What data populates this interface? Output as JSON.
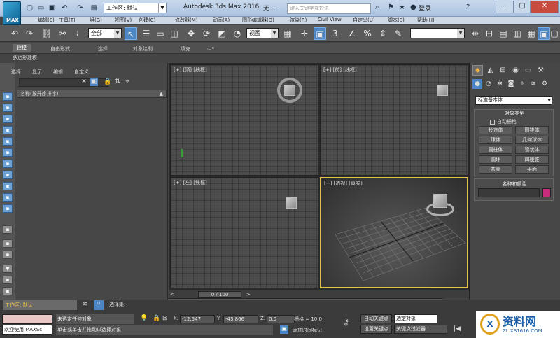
{
  "title": {
    "app": "Autodesk 3ds Max 2016",
    "doc": "无...",
    "workspace": "工作区: 默认",
    "search_placeholder": "键入关键字或短语",
    "login": "登录",
    "logo": "MAX"
  },
  "menu": [
    "编辑(E)",
    "工具(T)",
    "组(G)",
    "视图(V)",
    "创建(C)",
    "修改器(M)",
    "动画(A)",
    "图形编辑器(D)",
    "渲染(R)",
    "Civil View",
    "自定义(U)",
    "脚本(S)",
    "帮助(H)"
  ],
  "toolbar": {
    "filter": "全部",
    "refcoord": "视图"
  },
  "ribbon": [
    "建模",
    "自由形式",
    "选择",
    "对象绘制",
    "填充"
  ],
  "polybar": "多边形建模",
  "scene": {
    "tabs": [
      "选择",
      "显示",
      "编辑",
      "自定义"
    ],
    "header": "名称(按升序排序)"
  },
  "viewports": {
    "top": "[+] [顶] [线框]",
    "front": "[+] [前] [线框]",
    "left": "[+] [左] [线框]",
    "persp": "[+] [透视] [真实]"
  },
  "timeline": {
    "frame": "0 / 100",
    "ticks": [
      "0",
      "10",
      "20",
      "30",
      "40",
      "50",
      "60",
      "70",
      "80",
      "90",
      "100"
    ]
  },
  "command": {
    "dropdown": "标准基本体",
    "objtype_header": "对象类型",
    "autogrid": "自动栅格",
    "buttons": [
      "长方体",
      "圆锥体",
      "球体",
      "几何球体",
      "圆柱体",
      "管状体",
      "圆环",
      "四棱锥",
      "茶壶",
      "平面"
    ],
    "namecolor_header": "名称和颜色",
    "swatch_color": "#c72d7b"
  },
  "status": {
    "workspace": "工作区: 默认",
    "selset": "选择集:",
    "welcome": "欢迎使用 MAXSc",
    "selected": "未选定任何对象",
    "prompt": "单击或单击并拖动以选择对象",
    "x_label": "X:",
    "x": "-12.547",
    "y_label": "Y:",
    "y": "-43.866",
    "z_label": "Z:",
    "z": "0.0",
    "grid": "栅格 = 10.0",
    "addtime": "添加时间标记",
    "autokey": "自动关键点",
    "selobj": "选定对象",
    "setkey": "设置关键点",
    "keyfilters": "关键点过滤器..."
  },
  "watermark": {
    "name": "资料网",
    "url": "ZL.XS1616.COM"
  }
}
